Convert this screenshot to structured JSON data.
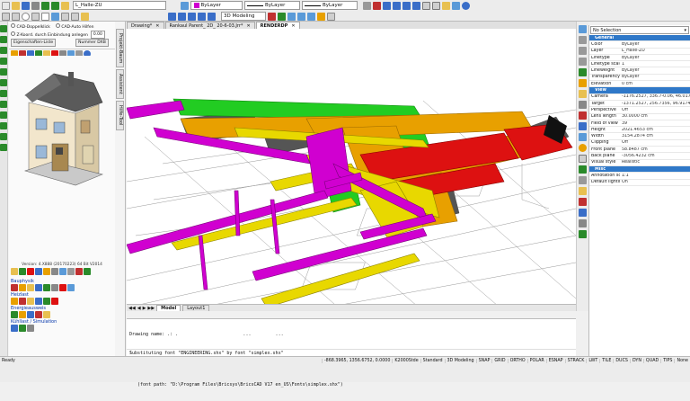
{
  "toolbar": {
    "layer_value": "L_Halle-ZU",
    "color_value": "ByLayer",
    "linetype_value": "ByLayer",
    "lineweight_value": "ByLayer",
    "workspace_value": "3D Modeling"
  },
  "doc_tabs": [
    {
      "label": "Drawing*",
      "active": false
    },
    {
      "label": "Rankaul Parent_ 2D_ 20-6-03.Jrr*",
      "active": false
    },
    {
      "label": "RENDERDP",
      "active": true
    }
  ],
  "left_panel": {
    "top_options": {
      "check1": "CAD-Doppelklick",
      "check2": "CAD-Auto Hilfen",
      "check3": "Z-Koord. durch Einbindung anlegen",
      "field_value": "0.00",
      "button1": "Eigenschaften-Liste",
      "button2": "Nummer DXB"
    },
    "side_tabs": [
      "Projekt-Baum",
      "Assistent",
      "Hilfe-Tool"
    ],
    "version": "Version: 4.X888 (20170223) 64 Bit V2014",
    "groups": [
      "Bauphysik",
      "Heizlast",
      "Energieausweis",
      "Kühllast / Simulation"
    ]
  },
  "viewport": {
    "model_tab": "Model",
    "layout_tab": "Layout1"
  },
  "command_line": {
    "lines": [
      "Drawing name: .: .                        ...         ...",
      "Substituting font \"ENGINEERING.shx\" by font \"simplex.shx\"",
      "",
      "   (font path: \"D:\\Program Files\\Bricsys\\BricsCAD V17 en_US\\Fonts\\simplex.shx\")"
    ],
    "prompt": ":"
  },
  "properties": {
    "selection": "No Selection",
    "sections": [
      {
        "title": "General",
        "rows": [
          [
            "Color",
            "ByLayer"
          ],
          [
            "Layer",
            "L_Halle-ZU"
          ],
          [
            "Linetype",
            "ByLayer"
          ],
          [
            "Linetype scale",
            "1"
          ],
          [
            "Lineweight",
            "ByLayer"
          ],
          [
            "Transparency",
            "ByLayer"
          ],
          [
            "Elevation",
            "0 cm"
          ]
        ]
      },
      {
        "title": "View",
        "rows": [
          [
            "Camera",
            "-1176.2527, 336.7-0.06, 46.0174"
          ],
          [
            "Target",
            "-1371.2527, 256.7356, 96.9174"
          ],
          [
            "Perspective",
            "Off"
          ],
          [
            "Lens length",
            "30.0000 cm"
          ],
          [
            "Field of view",
            "39"
          ],
          [
            "Height",
            "2021.4653 cm"
          ],
          [
            "Width",
            "3154.2874 cm"
          ],
          [
            "Clipping",
            "Off"
          ],
          [
            "Front plane",
            "58.8487 cm"
          ],
          [
            "Back plane",
            "-3056.4232 cm"
          ],
          [
            "Visual style",
            "Realistic"
          ]
        ]
      },
      {
        "title": "Misc",
        "rows": [
          [
            "Annotation scale",
            "1:1"
          ],
          [
            "Default lighting",
            "On"
          ]
        ]
      }
    ]
  },
  "status_bar": {
    "left": "Ready",
    "coords": "-868.3965, 1356.6752, 0.0000",
    "style": "K2000Stde",
    "dim": "Standard",
    "workspace": "3D Modeling",
    "toggles": [
      "SNAP",
      "GRID",
      "ORTHO",
      "POLAR",
      "ESNAP",
      "STRACK",
      "LWT",
      "TILE",
      "DUCS",
      "DYN",
      "QUAD",
      "TIPS",
      "None"
    ]
  },
  "colors": {
    "duct_magenta": "#d000d0",
    "duct_yellow": "#e8d800",
    "duct_orange": "#e8a000",
    "duct_green": "#22cc22",
    "duct_red": "#dd1111",
    "header_blue": "#2f78c8"
  }
}
